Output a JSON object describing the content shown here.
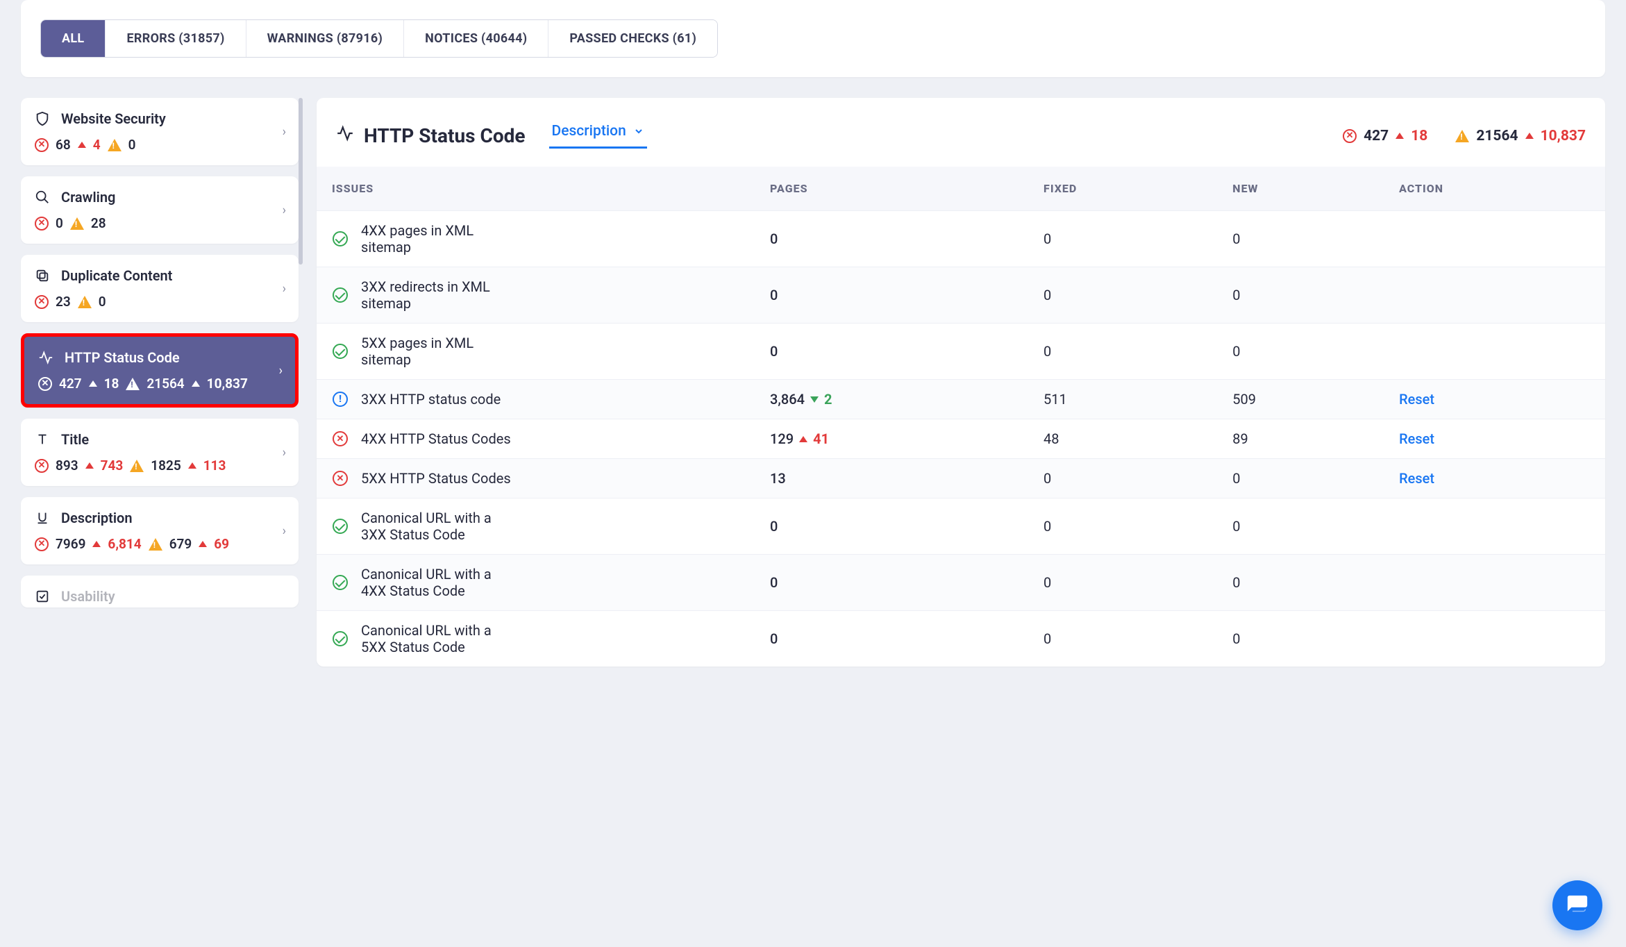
{
  "tabs": {
    "all": "ALL",
    "errors": "ERRORS (31857)",
    "warnings": "WARNINGS (87916)",
    "notices": "NOTICES (40644)",
    "passed": "PASSED CHECKS (61)"
  },
  "sidebar": [
    {
      "icon": "shield",
      "title": "Website Security",
      "err": "68",
      "err_delta": "4",
      "err_dir": "up",
      "warn": "0",
      "warn_delta": "",
      "active": false
    },
    {
      "icon": "search",
      "title": "Crawling",
      "err": "0",
      "err_delta": "",
      "err_dir": "",
      "warn": "28",
      "warn_delta": "",
      "active": false
    },
    {
      "icon": "copy",
      "title": "Duplicate Content",
      "err": "23",
      "err_delta": "",
      "err_dir": "",
      "warn": "0",
      "warn_delta": "",
      "active": false
    },
    {
      "icon": "pulse",
      "title": "HTTP Status Code",
      "err": "427",
      "err_delta": "18",
      "err_dir": "up",
      "warn": "21564",
      "warn_delta": "10,837",
      "active": true
    },
    {
      "icon": "text",
      "title": "Title",
      "err": "893",
      "err_delta": "743",
      "err_dir": "up",
      "warn": "1825",
      "warn_delta": "113",
      "active": false
    },
    {
      "icon": "underline",
      "title": "Description",
      "err": "7969",
      "err_delta": "6,814",
      "err_dir": "up",
      "warn": "679",
      "warn_delta": "69",
      "active": false
    },
    {
      "icon": "check",
      "title": "Usability",
      "err": "",
      "err_delta": "",
      "err_dir": "",
      "warn": "",
      "warn_delta": "",
      "active": false
    }
  ],
  "main": {
    "title": "HTTP Status Code",
    "desc_tab": "Description",
    "err": "427",
    "err_delta": "18",
    "warn": "21564",
    "warn_delta": "10,837",
    "columns": {
      "issues": "ISSUES",
      "pages": "PAGES",
      "fixed": "FIXED",
      "new": "NEW",
      "action": "ACTION"
    },
    "rows": [
      {
        "status": "ok",
        "issue": "4XX pages in XML sitemap",
        "pages": "0",
        "pdelta": "",
        "pdir": "",
        "fixed": "0",
        "new": "0",
        "action": ""
      },
      {
        "status": "ok",
        "issue": "3XX redirects in XML sitemap",
        "pages": "0",
        "pdelta": "",
        "pdir": "",
        "fixed": "0",
        "new": "0",
        "action": ""
      },
      {
        "status": "ok",
        "issue": "5XX pages in XML sitemap",
        "pages": "0",
        "pdelta": "",
        "pdir": "",
        "fixed": "0",
        "new": "0",
        "action": ""
      },
      {
        "status": "info",
        "issue": "3XX HTTP status code",
        "pages": "3,864",
        "pdelta": "2",
        "pdir": "dn",
        "fixed": "511",
        "new": "509",
        "action": "Reset"
      },
      {
        "status": "err",
        "issue": "4XX HTTP Status Codes",
        "pages": "129",
        "pdelta": "41",
        "pdir": "up",
        "fixed": "48",
        "new": "89",
        "action": "Reset"
      },
      {
        "status": "err",
        "issue": "5XX HTTP Status Codes",
        "pages": "13",
        "pdelta": "",
        "pdir": "",
        "fixed": "0",
        "new": "0",
        "action": "Reset"
      },
      {
        "status": "ok",
        "issue": "Canonical URL with a 3XX Status Code",
        "pages": "0",
        "pdelta": "",
        "pdir": "",
        "fixed": "0",
        "new": "0",
        "action": ""
      },
      {
        "status": "ok",
        "issue": "Canonical URL with a 4XX Status Code",
        "pages": "0",
        "pdelta": "",
        "pdir": "",
        "fixed": "0",
        "new": "0",
        "action": ""
      },
      {
        "status": "ok",
        "issue": "Canonical URL with a 5XX Status Code",
        "pages": "0",
        "pdelta": "",
        "pdir": "",
        "fixed": "0",
        "new": "0",
        "action": ""
      }
    ]
  }
}
